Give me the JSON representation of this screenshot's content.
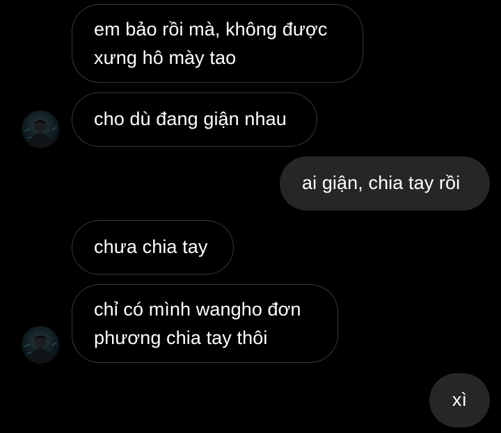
{
  "messages": [
    {
      "sender": "other",
      "lines": [
        "em bảo rồi mà, không được",
        "xưng hô mày tao"
      ]
    },
    {
      "sender": "other",
      "lines": [
        "cho dù đang giận nhau"
      ]
    },
    {
      "sender": "me",
      "lines": [
        "ai giận, chia tay rồi"
      ]
    },
    {
      "sender": "other",
      "lines": [
        "chưa chia tay"
      ]
    },
    {
      "sender": "other",
      "lines": [
        "chỉ có mình wangho đơn",
        "phương chia tay thôi"
      ]
    },
    {
      "sender": "me",
      "lines": [
        "xì"
      ]
    }
  ],
  "colors": {
    "background": "#000000",
    "incoming_border": "#3a3a3c",
    "outgoing_fill": "#262626",
    "text": "#ffffff"
  }
}
